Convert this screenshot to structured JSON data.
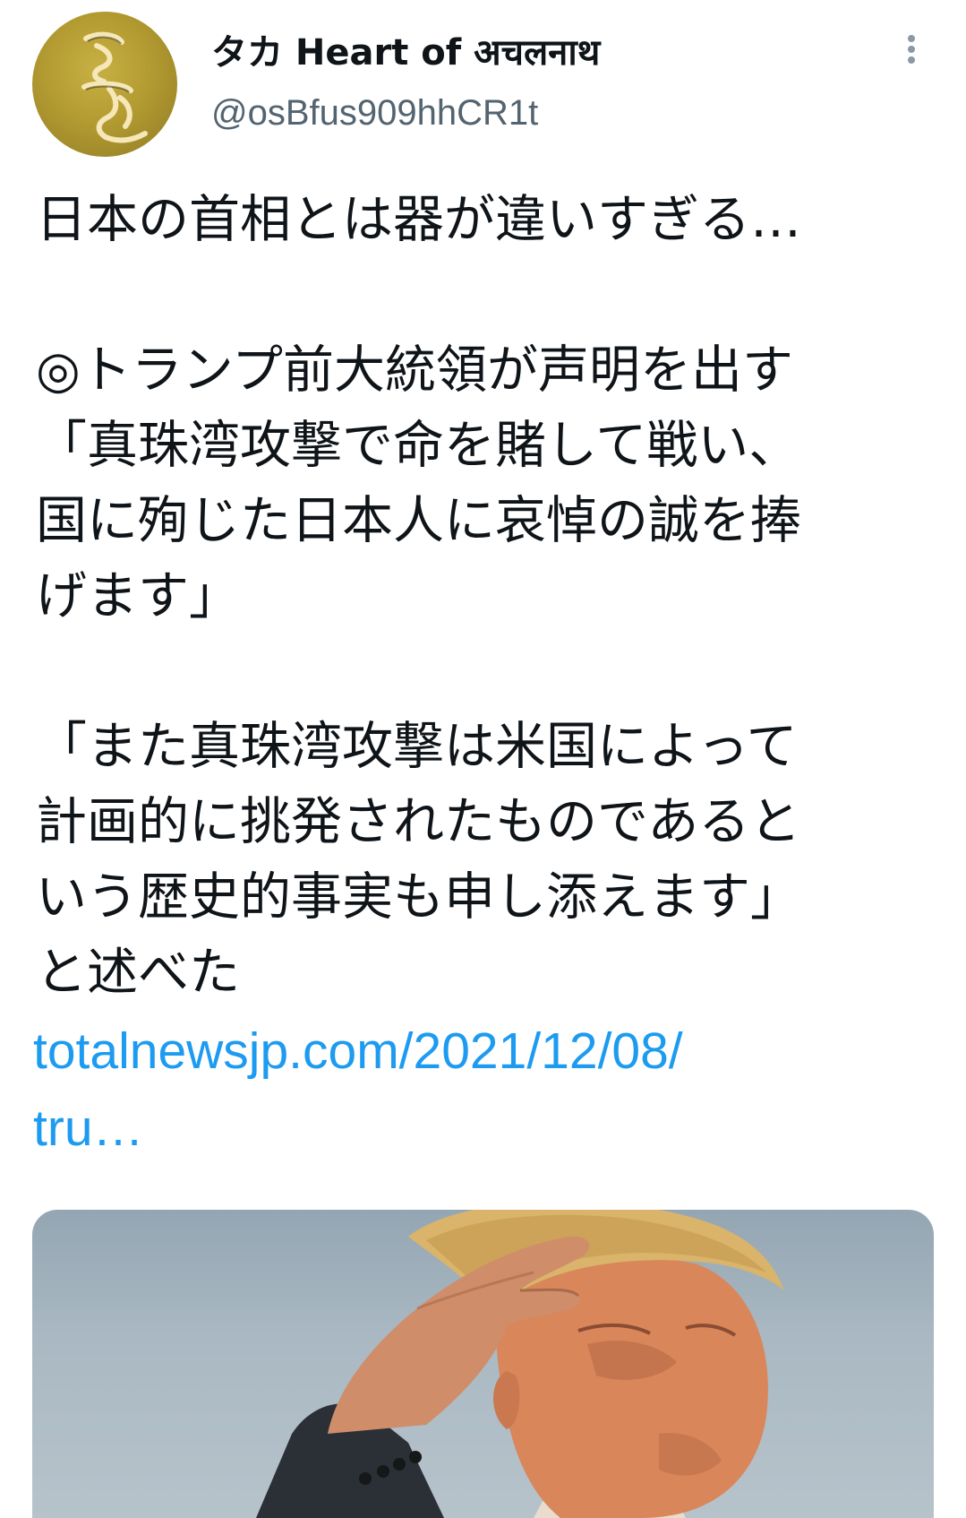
{
  "author": {
    "display_name": "タカ Heart of अचलनाथ",
    "handle": "@osBfus909hhCR1t",
    "avatar_icon": "sanskrit-seed-syllable-icon",
    "avatar_color": "#b39b32"
  },
  "tweet": {
    "lines": [
      "日本の首相とは器が違いすぎる…",
      "",
      "◎トランプ前大統領が声明を出す",
      "「真珠湾攻撃で命を賭して戦い、",
      "国に殉じた日本人に哀悼の誠を捧",
      "げます」",
      "",
      "「また真珠湾攻撃は米国によって",
      "計画的に挑発されたものであると",
      "いう歴史的事実も申し添えます」",
      "と述べた"
    ],
    "link_line1": "totalnewsjp.com/2021/12/08/",
    "link_line2": "tru…",
    "link_color": "#1d9bf0"
  },
  "more_menu_icon": "vertical-dots-icon",
  "media": {
    "icon": "photo-saluting-man"
  }
}
